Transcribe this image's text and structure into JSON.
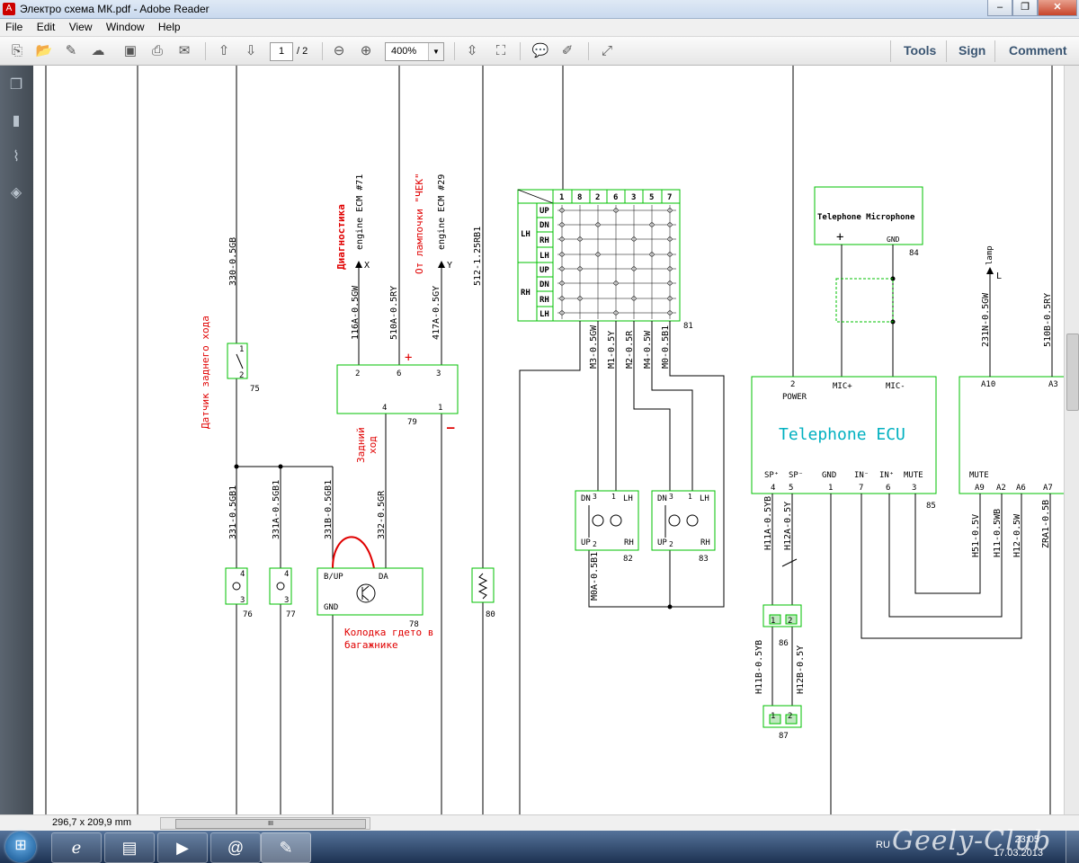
{
  "window": {
    "title": "Электро схема МК.pdf - Adobe Reader",
    "btn_min": "‒",
    "btn_max": "❐",
    "btn_close": "✕"
  },
  "menu": [
    "File",
    "Edit",
    "View",
    "Window",
    "Help"
  ],
  "toolbar": {
    "page_current": "1",
    "page_total": "/ 2",
    "zoom": "400%",
    "tools": "Tools",
    "sign": "Sign",
    "comment": "Comment"
  },
  "status": {
    "page_size": "296,7 x 209,9 mm",
    "scroll_grip": "III"
  },
  "taskbar": {
    "lang": "RU",
    "watermark": "Geely-Club",
    "time": "23:05",
    "date": "17.03.2013"
  },
  "diagram": {
    "wires": {
      "w330": "330-0.5GB",
      "w116": "116A-0.5GW",
      "w510a": "510A-0.5RY",
      "w417": "417A-0.5GY",
      "w512": "512-1.25RB1",
      "w331": "331-0.5GB1",
      "w331a": "331A-0.5GB1",
      "w331b": "331B-0.5GB1",
      "w332": "332-0.5GR",
      "w231": "231N-0.5GW",
      "w510b": "510B-0.5RY",
      "m3": "M3-0.5GW",
      "m1": "M1-0.5Y",
      "m2": "M2-0.5R",
      "m4": "M4-0.5W",
      "m0": "M0-0.5B1",
      "m0a": "M0A-0.5B1",
      "h11a": "H11A-0.5YB",
      "h12a": "H12A-0.5Y",
      "h11b": "H11B-0.5YB",
      "h12b": "H12B-0.5Y",
      "h51": "H51-0.5V",
      "h11": "H11-0.5WB",
      "h12": "H12-0.5W",
      "zra1": "ZRA1-0.5B"
    },
    "labels": {
      "engine71": "engine ECM #71",
      "engine29": "engine ECM #29",
      "x": "X",
      "y": "Y",
      "lamp": "lamp",
      "l": "L",
      "diag_ru": "Диагностика",
      "lamp_ru": "От лампочки \"ЧЕК\"",
      "reverse_sensor_ru": "Датчик заднего хода",
      "reverse_ru_1": "Задний",
      "reverse_ru_2": "ход",
      "trunk_ru_1": "Колодка гдето в",
      "trunk_ru_2": "багажнике",
      "plus": "+",
      "minus": "—",
      "tel_mic": "Telephone Microphone",
      "tel_ecu": "Telephone ECU",
      "power": "POWER",
      "mic_plus": "MIC+",
      "mic_minus": "MIC-",
      "gnd": "GND",
      "mute": "MUTE",
      "sp_plus": "SP⁺",
      "sp_minus": "SP⁻",
      "in_minus": "IN⁻",
      "in_plus": "IN⁺",
      "bup": "B/UP",
      "da": "DA"
    },
    "pins": {
      "p1": "1",
      "p2": "2",
      "p3": "3",
      "p4": "4",
      "p5": "5",
      "p6": "6",
      "p7": "7",
      "a10": "A10",
      "a3": "A3",
      "a9": "A9",
      "a2": "A2",
      "a6": "A6",
      "a7": "A7"
    },
    "components": {
      "c75": "75",
      "c76": "76",
      "c77": "77",
      "c78": "78",
      "c79": "79",
      "c80": "80",
      "c81": "81",
      "c82": "82",
      "c83": "83",
      "c84": "84",
      "c85": "85",
      "c86": "86",
      "c87": "87"
    },
    "switch81": {
      "cols": [
        "1",
        "8",
        "2",
        "6",
        "3",
        "5",
        "7"
      ],
      "rows": [
        "UP",
        "DN",
        "RH",
        "LH",
        "UP",
        "DN",
        "RH",
        "LH"
      ],
      "groups": [
        "LH",
        "RH"
      ]
    },
    "motor": {
      "dn": "DN",
      "up": "UP",
      "lh": "LH",
      "rh": "RH"
    }
  }
}
